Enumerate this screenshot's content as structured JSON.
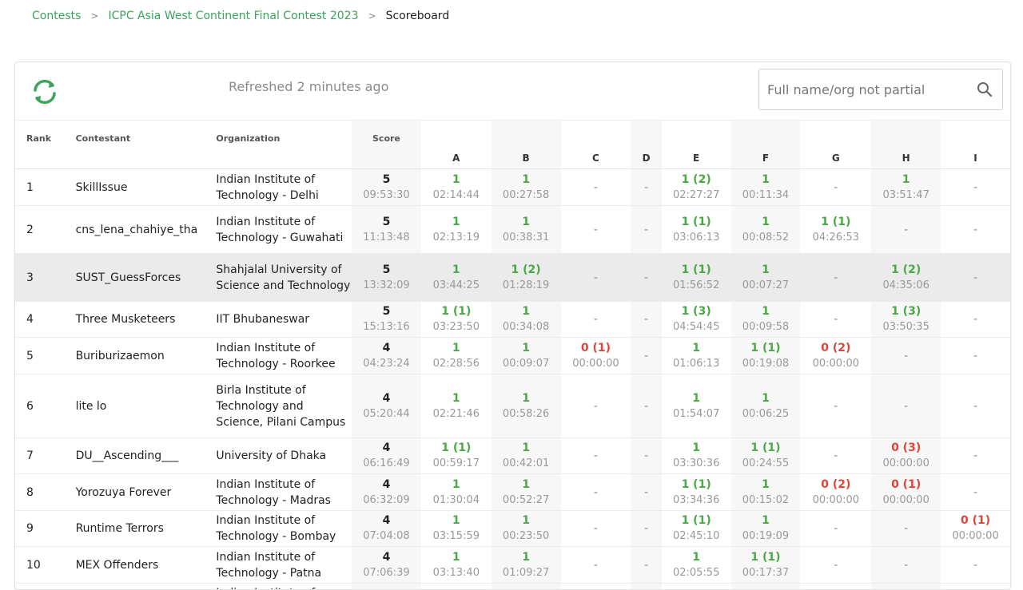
{
  "breadcrumb": {
    "contests": "Contests",
    "contest": "ICPC Asia West Continent Final Contest 2023",
    "current": "Scoreboard",
    "separator": ">"
  },
  "toolbar": {
    "refreshed": "Refreshed 2 minutes ago",
    "search_placeholder": "Full name/org not partial"
  },
  "colors": {
    "accent": "#3aa35c",
    "solved": "#4aa845",
    "failed": "#e0453a"
  },
  "columns": {
    "rank": "Rank",
    "contestant": "Contestant",
    "organization": "Organization",
    "score": "Score",
    "problems": [
      "A",
      "B",
      "C",
      "D",
      "E",
      "F",
      "G",
      "H",
      "I"
    ]
  },
  "rows": [
    {
      "rank": "1",
      "name": "SkillIssue",
      "org": "Indian Institute of Technology - Delhi",
      "solved": "5",
      "penalty": "09:53:30",
      "cells": [
        [
          "s",
          "1",
          "02:14:44"
        ],
        [
          "s",
          "1",
          "00:27:58"
        ],
        [
          "n"
        ],
        [
          "n"
        ],
        [
          "s",
          "1 (2)",
          "02:27:27"
        ],
        [
          "s",
          "1",
          "00:11:34"
        ],
        [
          "n"
        ],
        [
          "s",
          "1",
          "03:51:47"
        ],
        [
          "n"
        ]
      ]
    },
    {
      "rank": "2",
      "name": "cns_lena_chahiye_tha",
      "org": "Indian Institute of Technology - Guwahati",
      "solved": "5",
      "penalty": "11:13:48",
      "cells": [
        [
          "s",
          "1",
          "02:13:19"
        ],
        [
          "s",
          "1",
          "00:38:31"
        ],
        [
          "n"
        ],
        [
          "n"
        ],
        [
          "s",
          "1 (1)",
          "03:06:13"
        ],
        [
          "s",
          "1",
          "00:08:52"
        ],
        [
          "s",
          "1 (1)",
          "04:26:53"
        ],
        [
          "n"
        ],
        [
          "n"
        ]
      ]
    },
    {
      "rank": "3",
      "name": "SUST_GuessForces",
      "org": "Shahjalal University of Science and Technology",
      "solved": "5",
      "penalty": "13:32:09",
      "highlight": true,
      "cells": [
        [
          "s",
          "1",
          "03:44:25"
        ],
        [
          "s",
          "1 (2)",
          "01:28:19"
        ],
        [
          "n"
        ],
        [
          "n"
        ],
        [
          "s",
          "1 (1)",
          "01:56:52"
        ],
        [
          "s",
          "1",
          "00:07:27"
        ],
        [
          "n"
        ],
        [
          "s",
          "1 (2)",
          "04:35:06"
        ],
        [
          "n"
        ]
      ]
    },
    {
      "rank": "4",
      "name": "Three Musketeers",
      "org": "IIT Bhubaneswar",
      "solved": "5",
      "penalty": "15:13:16",
      "cells": [
        [
          "s",
          "1 (1)",
          "03:23:50"
        ],
        [
          "s",
          "1",
          "00:34:08"
        ],
        [
          "n"
        ],
        [
          "n"
        ],
        [
          "s",
          "1 (3)",
          "04:54:45"
        ],
        [
          "s",
          "1",
          "00:09:58"
        ],
        [
          "n"
        ],
        [
          "s",
          "1 (3)",
          "03:50:35"
        ],
        [
          "n"
        ]
      ]
    },
    {
      "rank": "5",
      "name": "Buriburizaemon",
      "org": "Indian Institute of Technology - Roorkee",
      "solved": "4",
      "penalty": "04:23:24",
      "cells": [
        [
          "s",
          "1",
          "02:28:56"
        ],
        [
          "s",
          "1",
          "00:09:07"
        ],
        [
          "f",
          "0 (1)",
          "00:00:00"
        ],
        [
          "n"
        ],
        [
          "s",
          "1",
          "01:06:13"
        ],
        [
          "s",
          "1 (1)",
          "00:19:08"
        ],
        [
          "f",
          "0 (2)",
          "00:00:00"
        ],
        [
          "n"
        ],
        [
          "n"
        ]
      ]
    },
    {
      "rank": "6",
      "name": "lite lo",
      "org": "Birla Institute of Technology and Science, Pilani Campus",
      "solved": "4",
      "penalty": "05:20:44",
      "cells": [
        [
          "s",
          "1",
          "02:21:46"
        ],
        [
          "s",
          "1",
          "00:58:26"
        ],
        [
          "n"
        ],
        [
          "n"
        ],
        [
          "s",
          "1",
          "01:54:07"
        ],
        [
          "s",
          "1",
          "00:06:25"
        ],
        [
          "n"
        ],
        [
          "n"
        ],
        [
          "n"
        ]
      ]
    },
    {
      "rank": "7",
      "name": "DU__Ascending___",
      "org": "University of Dhaka",
      "solved": "4",
      "penalty": "06:16:49",
      "cells": [
        [
          "s",
          "1 (1)",
          "00:59:17"
        ],
        [
          "s",
          "1",
          "00:42:01"
        ],
        [
          "n"
        ],
        [
          "n"
        ],
        [
          "s",
          "1",
          "03:30:36"
        ],
        [
          "s",
          "1 (1)",
          "00:24:55"
        ],
        [
          "n"
        ],
        [
          "f",
          "0 (3)",
          "00:00:00"
        ],
        [
          "n"
        ]
      ]
    },
    {
      "rank": "8",
      "name": "Yorozuya Forever",
      "org": "Indian Institute of Technology - Madras",
      "solved": "4",
      "penalty": "06:32:09",
      "cells": [
        [
          "s",
          "1",
          "01:30:04"
        ],
        [
          "s",
          "1",
          "00:52:27"
        ],
        [
          "n"
        ],
        [
          "n"
        ],
        [
          "s",
          "1 (1)",
          "03:34:36"
        ],
        [
          "s",
          "1",
          "00:15:02"
        ],
        [
          "f",
          "0 (2)",
          "00:00:00"
        ],
        [
          "f",
          "0 (1)",
          "00:00:00"
        ],
        [
          "n"
        ]
      ]
    },
    {
      "rank": "9",
      "name": "Runtime Terrors",
      "org": "Indian Institute of Technology - Bombay",
      "solved": "4",
      "penalty": "07:04:08",
      "cells": [
        [
          "s",
          "1",
          "03:15:59"
        ],
        [
          "s",
          "1",
          "00:23:50"
        ],
        [
          "n"
        ],
        [
          "n"
        ],
        [
          "s",
          "1 (1)",
          "02:45:10"
        ],
        [
          "s",
          "1",
          "00:19:09"
        ],
        [
          "n"
        ],
        [
          "n"
        ],
        [
          "f",
          "0 (1)",
          "00:00:00"
        ]
      ]
    },
    {
      "rank": "10",
      "name": "MEX Offenders",
      "org": "Indian Institute of Technology - Patna",
      "solved": "4",
      "penalty": "07:06:39",
      "cells": [
        [
          "s",
          "1",
          "03:13:40"
        ],
        [
          "s",
          "1",
          "01:09:27"
        ],
        [
          "n"
        ],
        [
          "n"
        ],
        [
          "s",
          "1",
          "02:05:55"
        ],
        [
          "s",
          "1 (1)",
          "00:17:37"
        ],
        [
          "n"
        ],
        [
          "n"
        ],
        [
          "n"
        ]
      ]
    },
    {
      "rank": "",
      "name": "",
      "org": "Indian Institute of",
      "solved": "",
      "penalty": "",
      "cells": [
        [
          "n"
        ],
        [
          "n"
        ],
        [
          "n"
        ],
        [
          "n"
        ],
        [
          "n"
        ],
        [
          "n"
        ],
        [
          "n"
        ],
        [
          "n"
        ],
        [
          "n"
        ]
      ]
    }
  ]
}
